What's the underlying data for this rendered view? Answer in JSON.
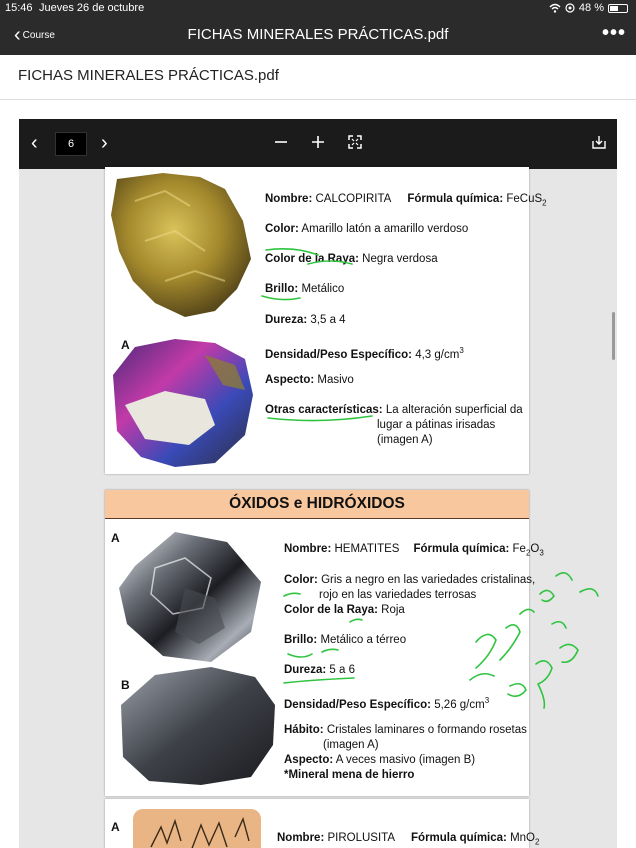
{
  "status_bar": {
    "time": "15:46",
    "date": "Jueves 26 de octubre",
    "battery": "48 %",
    "battery_level": 0.48
  },
  "nav": {
    "back_label": "Course",
    "title": "FICHAS MINERALES PRÁCTICAS.pdf"
  },
  "document": {
    "title": "FICHAS MINERALES PRÁCTICAS.pdf"
  },
  "toolbar": {
    "page_number": "6"
  },
  "colors": {
    "bar": "#2b2b2b",
    "toolbar": "#1b1b1b",
    "section_header": "#f8c79e",
    "annotation_ink": "#2fc43f"
  },
  "icons": [
    "chevron-left-icon",
    "more-icon",
    "wifi-icon",
    "battery-icon",
    "minus-icon",
    "plus-icon",
    "fullscreen-icon",
    "download-icon"
  ],
  "pdf": {
    "calcopirita": {
      "nombre_label": "Nombre:",
      "nombre": "CALCOPIRITA",
      "formula_label": "Fórmula química:",
      "formula": "FeCuS",
      "formula_sub": "2",
      "color_label": "Color:",
      "color": "Amarillo latón a amarillo verdoso",
      "raya_label": "Color de la Raya:",
      "raya": "Negra verdosa",
      "brillo_label": "Brillo:",
      "brillo": "Metálico",
      "dureza_label": "Dureza:",
      "dureza": "3,5 a 4",
      "densidad_label": "Densidad/Peso Específico:",
      "densidad": "4,3 g/cm",
      "densidad_sup": "3",
      "aspecto_label": "Aspecto:",
      "aspecto": "Masivo",
      "otras_label": "Otras características:",
      "otras_1": "La alteración superficial da",
      "otras_2": "lugar a pátinas irisadas",
      "otras_3": "(imagen A)",
      "img_label": "A"
    },
    "oxidos_header": "ÓXIDOS e HIDRÓXIDOS",
    "hematites": {
      "img_a": "A",
      "img_b": "B",
      "nombre_label": "Nombre:",
      "nombre": "HEMATITES",
      "formula_label": "Fórmula química:",
      "formula_a": "Fe",
      "formula_sub1": "2",
      "formula_b": "O",
      "formula_sub2": "3",
      "color_label": "Color:",
      "color_1": "Gris a negro en las variedades cristalinas,",
      "color_2": "rojo en las variedades terrosas",
      "raya_label": "Color de la Raya:",
      "raya": "Roja",
      "brillo_label": "Brillo:",
      "brillo": "Metálico a térreo",
      "dureza_label": "Dureza:",
      "dureza": "5 a 6",
      "densidad_label": "Densidad/Peso Específico:",
      "densidad": "5,26 g/cm",
      "densidad_sup": "3",
      "habito_label": "Hábito:",
      "habito_1": "Cristales laminares o formando rosetas",
      "habito_2": "(imagen A)",
      "aspecto_label": "Aspecto:",
      "aspecto": "A veces masivo (imagen B)",
      "nota": "*Mineral mena de hierro"
    },
    "pirolusita": {
      "img_a": "A",
      "nombre_label": "Nombre:",
      "nombre": "PIROLUSITA",
      "formula_label": "Fórmula química:",
      "formula": "MnO",
      "formula_sub": "2"
    }
  }
}
